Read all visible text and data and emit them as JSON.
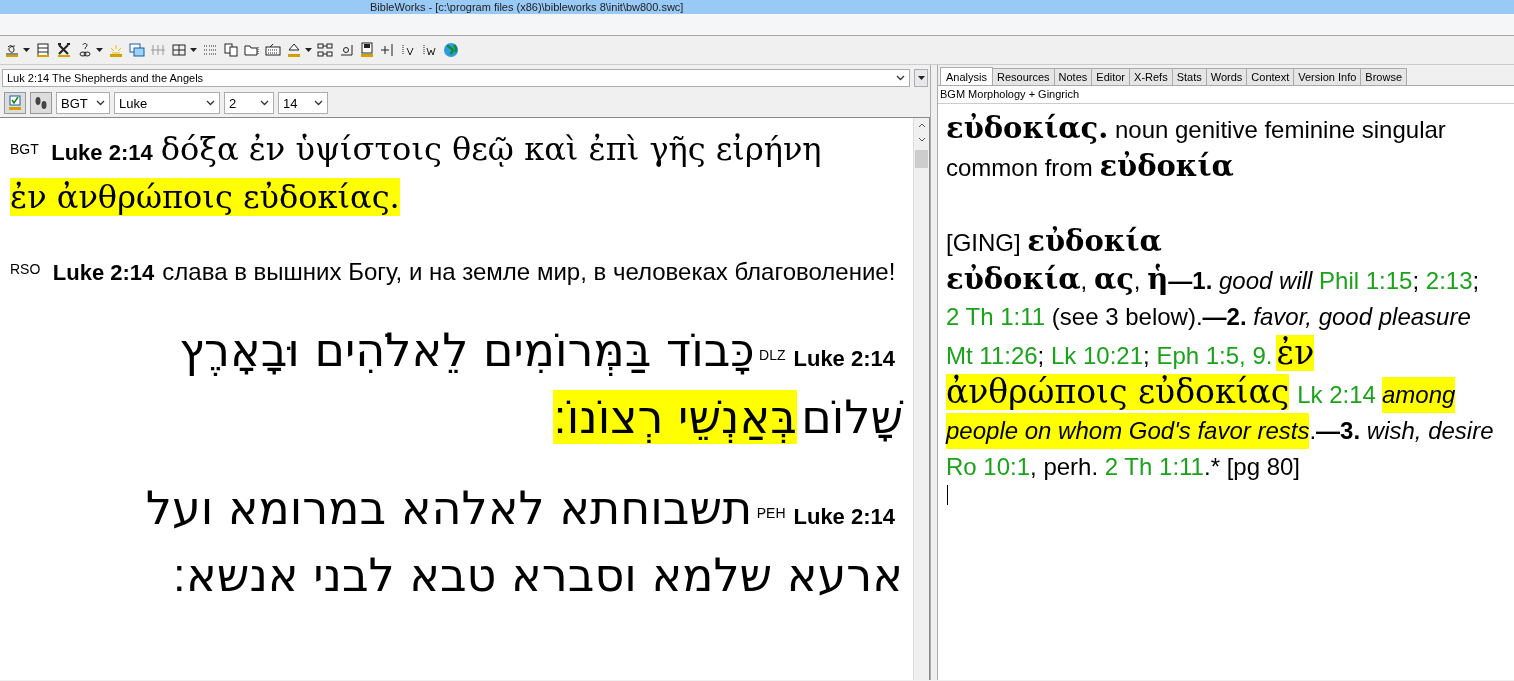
{
  "window": {
    "title": "BibleWorks - [c:\\program files (x86)\\bibleworks 8\\init\\bw800.swc]"
  },
  "passage_selector": {
    "value": "Luk 2:14 The Shepherds and the Angels"
  },
  "navigation": {
    "version": "BGT",
    "book": "Luke",
    "chapter": "2",
    "verse": "14"
  },
  "verses": [
    {
      "kind": "greek",
      "version": "BGT",
      "reference": "Luke 2:14",
      "segments": [
        {
          "text": "δόξα ἐν ὑψίστοις θεῷ καὶ ἐπὶ γῆς εἰρήνη",
          "highlight": false
        },
        {
          "text": "ἐν ἀνθρώποις εὐδοκίας.",
          "highlight": true
        }
      ]
    },
    {
      "kind": "plain",
      "version": "RSO",
      "reference": "Luke 2:14",
      "segments": [
        {
          "text": "слава в вышних Богу, и на земле мир, в человеках благоволение!",
          "highlight": false
        }
      ]
    },
    {
      "kind": "hebrew",
      "version": "DLZ",
      "reference": "Luke 2:14",
      "segments": [
        {
          "text": "כָּבוֹד בַּמְּרוֹמִים לֵאלֹהִים וּבָאָרֶץ",
          "highlight": false
        },
        {
          "text": "שָׁלוֹם",
          "highlight": false
        },
        {
          "text": "בְּאַנְשֵׁי רְצוֹנוֹ׃",
          "highlight": true
        }
      ]
    },
    {
      "kind": "hebrew",
      "version": "PEH",
      "reference": "Luke 2:14",
      "segments": [
        {
          "text": "תשבוחתא לאלהא במרומא ועל",
          "highlight": false
        },
        {
          "text": "ארעא שלמא וסברא טבא לבני אנשא׃",
          "highlight": false
        }
      ]
    }
  ],
  "tabs": [
    {
      "label": "Analysis",
      "selected": true
    },
    {
      "label": "Resources",
      "selected": false
    },
    {
      "label": "Notes",
      "selected": false
    },
    {
      "label": "Editor",
      "selected": false
    },
    {
      "label": "X-Refs",
      "selected": false
    },
    {
      "label": "Stats",
      "selected": false
    },
    {
      "label": "Words",
      "selected": false
    },
    {
      "label": "Context",
      "selected": false
    },
    {
      "label": "Version Info",
      "selected": false
    },
    {
      "label": "Browse",
      "selected": false
    }
  ],
  "analysis": {
    "subtitle": "BGM Morphology + Gingrich",
    "paragraphs": [
      [
        {
          "kind": "greek-bold",
          "text": "εὐδοκίας.",
          "highlight": false
        },
        {
          "kind": "plain",
          "text": "  noun genitive feminine singular common from ",
          "highlight": false
        },
        {
          "kind": "greek-bold",
          "text": "εὐδοκία",
          "highlight": false
        }
      ],
      [
        {
          "kind": "plain",
          "text": "[GING] ",
          "highlight": false
        },
        {
          "kind": "greek-bold",
          "text": "εὐδοκία",
          "highlight": false
        }
      ],
      [
        {
          "kind": "greek-bold",
          "text": "εὐδοκία",
          "highlight": false
        },
        {
          "kind": "plain",
          "text": ", ",
          "highlight": false
        },
        {
          "kind": "greek-bold",
          "text": "ας",
          "highlight": false
        },
        {
          "kind": "plain",
          "text": ", ",
          "highlight": false
        },
        {
          "kind": "greek-bold",
          "text": "ἡ",
          "highlight": false
        },
        {
          "kind": "bold",
          "text": "—1. ",
          "highlight": false
        },
        {
          "kind": "italic",
          "text": "good will ",
          "highlight": false
        },
        {
          "kind": "ref",
          "text": "Phil 1:15",
          "highlight": false
        },
        {
          "kind": "plain",
          "text": "; ",
          "highlight": false
        },
        {
          "kind": "ref",
          "text": "2:13",
          "highlight": false
        },
        {
          "kind": "plain",
          "text": "; ",
          "highlight": false
        },
        {
          "kind": "ref",
          "text": "2 Th 1:11",
          "highlight": false
        },
        {
          "kind": "plain",
          "text": " (see 3 below).",
          "highlight": false
        },
        {
          "kind": "bold",
          "text": "—2. ",
          "highlight": false
        },
        {
          "kind": "italic",
          "text": "favor, good pleasure ",
          "highlight": false
        },
        {
          "kind": "ref",
          "text": "Mt 11:26",
          "highlight": false
        },
        {
          "kind": "plain",
          "text": "; ",
          "highlight": false
        },
        {
          "kind": "ref",
          "text": "Lk 10:21",
          "highlight": false
        },
        {
          "kind": "plain",
          "text": "; ",
          "highlight": false
        },
        {
          "kind": "ref",
          "text": "Eph 1:5, 9.",
          "highlight": false
        },
        {
          "kind": "greek",
          "text": "ἐν",
          "highlight": true
        },
        {
          "kind": "greek",
          "text": "ἀνθρώποις εὐδοκίας",
          "highlight": true
        },
        {
          "kind": "ref",
          "text": "Lk 2:14",
          "highlight": false
        },
        {
          "kind": "italic",
          "text": "among",
          "highlight": true
        },
        {
          "kind": "italic",
          "text": "people on whom God's favor rests",
          "highlight": true
        },
        {
          "kind": "plain",
          "text": ".",
          "highlight": false
        },
        {
          "kind": "bold",
          "text": "—3. ",
          "highlight": false
        },
        {
          "kind": "italic",
          "text": "wish, desire ",
          "highlight": false
        },
        {
          "kind": "ref",
          "text": "Ro 10:1",
          "highlight": false
        },
        {
          "kind": "plain",
          "text": ", perh. ",
          "highlight": false
        },
        {
          "kind": "ref",
          "text": "2 Th 1:11",
          "highlight": false
        },
        {
          "kind": "plain",
          "text": ".* [pg 80]",
          "highlight": false
        }
      ]
    ]
  }
}
